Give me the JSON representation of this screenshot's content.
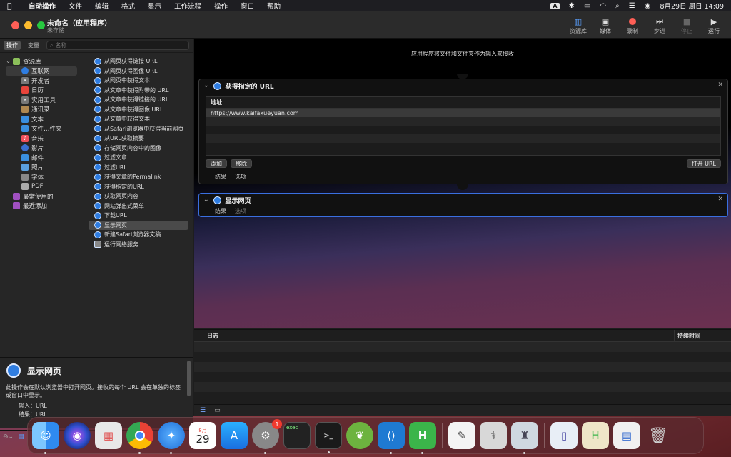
{
  "menubar": {
    "apple": "",
    "items": [
      "自动操作",
      "文件",
      "编辑",
      "格式",
      "显示",
      "工作流程",
      "操作",
      "窗口",
      "帮助"
    ],
    "input_badge": "A",
    "clock": "8月29日 周日  14:09"
  },
  "window": {
    "title": "未命名（应用程序）",
    "subtitle": "未存储",
    "toolbar": [
      {
        "label": "资源库",
        "icon": "▥"
      },
      {
        "label": "媒体",
        "icon": "▣"
      },
      {
        "label": "录制",
        "icon": "●"
      },
      {
        "label": "步进",
        "icon": "⏭"
      },
      {
        "label": "停止",
        "icon": "■"
      },
      {
        "label": "运行",
        "icon": "▶"
      }
    ]
  },
  "left": {
    "seg_actions": "操作",
    "seg_variables": "变量",
    "search_placeholder": "名称",
    "library": [
      {
        "label": "资源库",
        "icon": "library-icon",
        "color": "#8bbf5a"
      },
      {
        "label": "互联网",
        "icon": "internet-icon",
        "color": "#2f7de1"
      },
      {
        "label": "开发者",
        "icon": "developer-icon",
        "color": "#777777"
      },
      {
        "label": "日历",
        "icon": "calendar-icon",
        "color": "#e9443b"
      },
      {
        "label": "实用工具",
        "icon": "utilities-icon",
        "color": "#777777"
      },
      {
        "label": "通讯录",
        "icon": "contacts-icon",
        "color": "#b08850"
      },
      {
        "label": "文本",
        "icon": "text-icon",
        "color": "#3a8fe0"
      },
      {
        "label": "文件…件夹",
        "icon": "folder-icon",
        "color": "#3a8fe0"
      },
      {
        "label": "音乐",
        "icon": "music-icon",
        "color": "#f0505a"
      },
      {
        "label": "影片",
        "icon": "movie-icon",
        "color": "#3a6fd0"
      },
      {
        "label": "邮件",
        "icon": "mail-icon",
        "color": "#3a8fe0"
      },
      {
        "label": "照片",
        "icon": "photos-icon",
        "color": "#5aa0e0"
      },
      {
        "label": "字体",
        "icon": "fonts-icon",
        "color": "#888888"
      },
      {
        "label": "PDF",
        "icon": "pdf-icon",
        "color": "#aaaaaa"
      },
      {
        "label": "最常使用的",
        "icon": "smart-folder-icon",
        "color": "#a050c0"
      },
      {
        "label": "最近添加",
        "icon": "smart-folder-icon",
        "color": "#a050c0"
      }
    ],
    "actions": [
      "从网页获得链接 URL",
      "从网页获得图像 URL",
      "从网页中获得文本",
      "从文章中获得附带的 URL",
      "从文章中获得链接的 URL",
      "从文章中获得图像 URL",
      "从文章中获得文本",
      "从Safari浏览器中获得当前网页",
      "从URL获取摘要",
      "存储网页内容中的图像",
      "过滤文章",
      "过滤URL",
      "获得文章的Permalink",
      "获得指定的URL",
      "获取网页内容",
      "网站弹出式菜单",
      "下载URL",
      "显示网页",
      "新建Safari浏览器文稿",
      "运行网络服务"
    ],
    "description": {
      "title": "显示网页",
      "text": "此操作会在默认浏览器中打开网页。接收的每个 URL 会在单独的标签或窗口中显示。",
      "input_label": "输入：",
      "input_value": "URL",
      "result_label": "结果：",
      "result_value": "URL"
    }
  },
  "workflow": {
    "hint": "应用程序将文件和文件夹作为输入来接收",
    "action1": {
      "title": "获得指定的 URL",
      "column": "地址",
      "rows": [
        "https://www.kaifaxueyuan.com"
      ],
      "add": "添加",
      "remove": "移除",
      "open_url": "打开 URL",
      "tab_results": "结果",
      "tab_options": "选项"
    },
    "action2": {
      "title": "显示网页",
      "tab_results": "结果",
      "tab_options": "选项"
    }
  },
  "log": {
    "col_log": "日志",
    "col_duration": "持续时间"
  },
  "dock": {
    "calendar_month": "8月",
    "calendar_day": "29",
    "badge": "1",
    "terminal_text": "exec"
  }
}
